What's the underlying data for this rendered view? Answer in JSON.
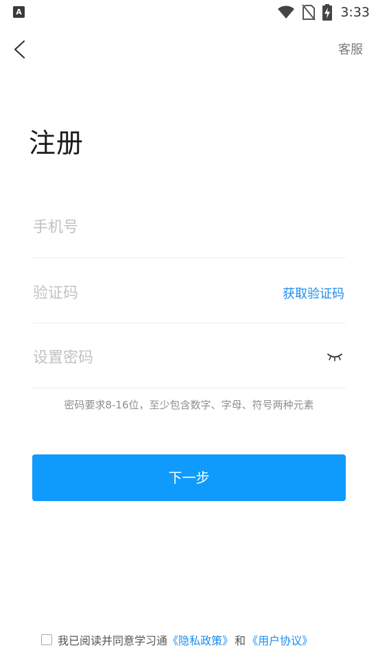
{
  "status_bar": {
    "app_icon_letter": "A",
    "time": "3:33",
    "icons": [
      "wifi-icon",
      "no-sim-icon",
      "battery-charging-icon"
    ]
  },
  "nav": {
    "back_icon": "chevron-left-icon",
    "service_label": "客服"
  },
  "page_title": "注册",
  "form": {
    "phone_placeholder": "手机号",
    "code_placeholder": "验证码",
    "get_code_label": "获取验证码",
    "password_placeholder": "设置密码",
    "password_toggle_icon": "eye-closed-icon",
    "password_hint": "密码要求8-16位，至少包含数字、字母、符号两种元素"
  },
  "next_button_label": "下一步",
  "agreement": {
    "prefix": "我已阅读并同意学习通",
    "privacy_link": "《隐私政策》",
    "and": "和",
    "terms_link": "《用户协议》"
  },
  "colors": {
    "accent": "#0f9bfb",
    "link": "#1a8cf0"
  }
}
